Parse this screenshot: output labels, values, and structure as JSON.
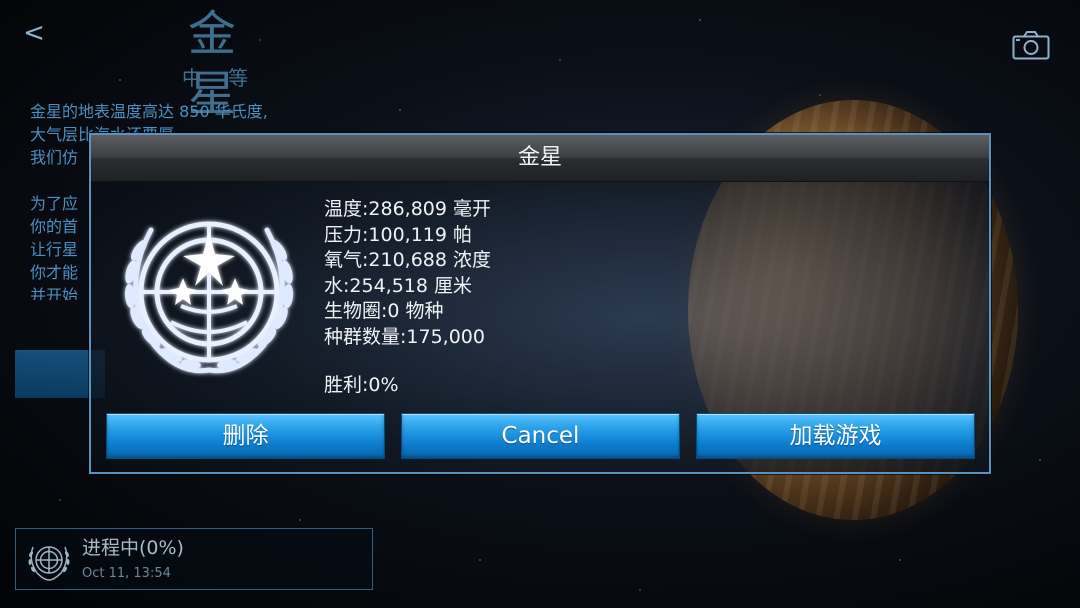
{
  "background": {
    "back_label": "<",
    "planet_name": "金 星",
    "difficulty": "中 等",
    "description": [
      "金星的地表温度高达 850 华氏度,\n大气层比海水还要厚\n我们仿",
      "为了应\n你的首\n让行星\n你才能\n并开始"
    ]
  },
  "save_slot": {
    "status": "进程中(0%)",
    "timestamp": "Oct 11, 13:54"
  },
  "dialog": {
    "title": "金星",
    "stats": [
      "温度:286,809 毫开",
      "压力:100,119 帕",
      "氧气:210,688 浓度",
      "水:254,518 厘米",
      "生物圈:0 物种",
      "种群数量:175,000"
    ],
    "victory": "胜利:0%",
    "buttons": {
      "delete": "删除",
      "cancel": "Cancel",
      "load": "加载游戏"
    }
  },
  "icons": {
    "camera": "camera-icon",
    "emblem": "un-emblem-icon"
  },
  "colors": {
    "button_blue": "#1d8fde",
    "dialog_border": "#5a91bf",
    "title_blue": "#3f6f8f"
  }
}
